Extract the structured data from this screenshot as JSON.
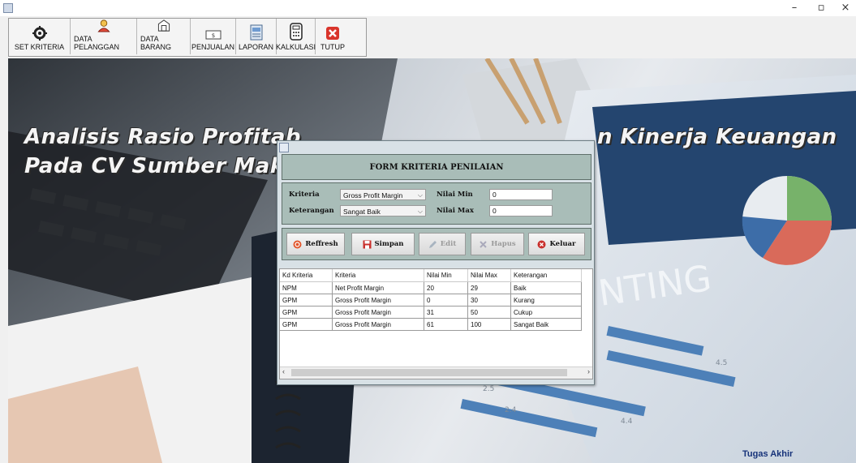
{
  "toolbar": {
    "items": [
      {
        "label": "SET KRITERIA",
        "icon": "gear-icon"
      },
      {
        "label": "DATA PELANGGAN",
        "icon": "customer-icon"
      },
      {
        "label": "DATA BARANG",
        "icon": "box-icon"
      },
      {
        "label": "PENJUALAN",
        "icon": "cash-icon"
      },
      {
        "label": "LAPORAN",
        "icon": "report-icon"
      },
      {
        "label": "KALKULASI",
        "icon": "calculator-icon"
      },
      {
        "label": "TUTUP",
        "icon": "close-icon"
      }
    ]
  },
  "window_controls": {
    "minimize": "–",
    "maximize": "▫",
    "close": "×"
  },
  "headline": {
    "line1_left": "Analisis Rasio Profitab",
    "line1_right": "n Kinerja Keuangan",
    "line2_left": "Pada CV Sumber Makr"
  },
  "footer": {
    "label": "Tugas Akhir"
  },
  "form": {
    "title": "FORM KRITERIA PENILAIAN",
    "kriteria_label": "Kriteria",
    "kriteria_value": "Gross Profit Margin",
    "keterangan_label": "Keterangan",
    "keterangan_value": "Sangat Baik",
    "nilai_min_label": "Nilai Min",
    "nilai_min_value": "0",
    "nilai_max_label": "Nilai Max",
    "nilai_max_value": "0",
    "buttons": {
      "refresh": "Reffresh",
      "simpan": "Simpan",
      "edit": "Edit",
      "hapus": "Hapus",
      "keluar": "Keluar"
    },
    "table": {
      "headers": [
        "Kd Kriteria",
        "Kriteria",
        "Nilai Min",
        "Nilai Max",
        "Keterangan"
      ],
      "rows": [
        [
          "NPM",
          "Net Profit Margin",
          "20",
          "29",
          "Baik"
        ],
        [
          "GPM",
          "Gross Profit Margin",
          "0",
          "30",
          "Kurang"
        ],
        [
          "GPM",
          "Gross Profit Margin",
          "31",
          "50",
          "Cukup"
        ],
        [
          "GPM",
          "Gross Profit Margin",
          "61",
          "100",
          "Sangat Baik"
        ]
      ]
    }
  },
  "colors": {
    "panel": "#a9bdb8",
    "footer_text": "#17337a",
    "close_red": "#d9342b"
  }
}
